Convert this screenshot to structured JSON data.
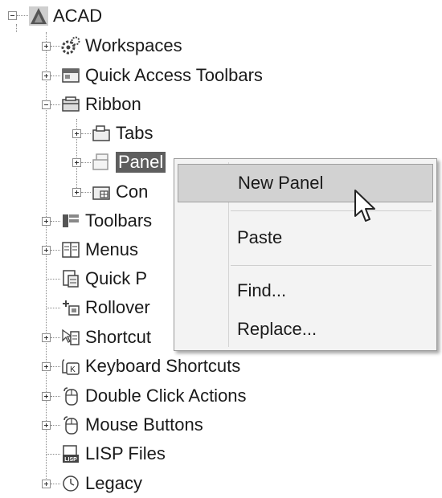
{
  "tree": {
    "root": {
      "label": "ACAD",
      "icon": "autocad-logo-icon"
    },
    "items": [
      {
        "label": "Workspaces",
        "icon": "gears-icon"
      },
      {
        "label": "Quick Access Toolbars",
        "icon": "toolbar-icon"
      },
      {
        "label": "Ribbon",
        "icon": "ribbon-folder-icon"
      },
      {
        "label": "Tabs",
        "icon": "tabs-icon"
      },
      {
        "label": "Panel",
        "icon": "panels-icon"
      },
      {
        "label": "Con",
        "icon": "contextual-icon"
      },
      {
        "label": "Toolbars",
        "icon": "toolbars-icon"
      },
      {
        "label": "Menus",
        "icon": "menus-icon"
      },
      {
        "label": "Quick P",
        "icon": "quick-properties-icon"
      },
      {
        "label": "Rollover",
        "icon": "rollover-icon"
      },
      {
        "label": "Shortcut",
        "icon": "shortcut-menus-icon"
      },
      {
        "label": "Keyboard Shortcuts",
        "icon": "keyboard-icon"
      },
      {
        "label": "Double Click Actions",
        "icon": "mouse-icon"
      },
      {
        "label": "Mouse Buttons",
        "icon": "mouse-icon"
      },
      {
        "label": "LISP Files",
        "icon": "lisp-file-icon"
      },
      {
        "label": "Legacy",
        "icon": "legacy-icon"
      }
    ]
  },
  "context_menu": {
    "items": [
      {
        "label": "New Panel"
      },
      {
        "label": "Paste"
      },
      {
        "label": "Find..."
      },
      {
        "label": "Replace..."
      }
    ]
  },
  "colors": {
    "selection": "#5e5e5e",
    "menu_bg": "#f3f3f3",
    "menu_hover": "#d2d2d2"
  }
}
